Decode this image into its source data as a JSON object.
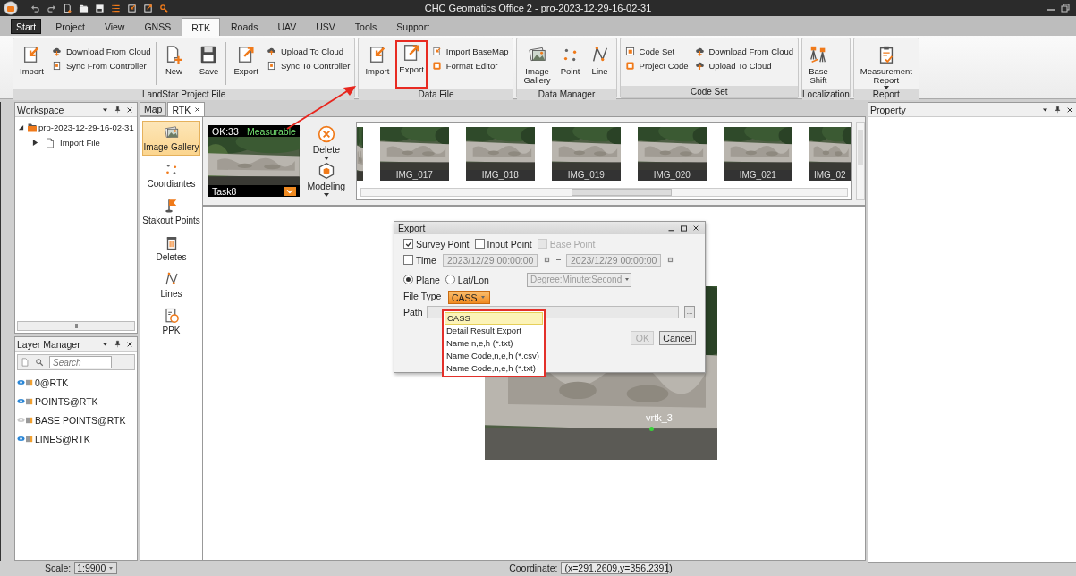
{
  "window": {
    "title": "CHC Geomatics Office 2 - pro-2023-12-29-16-02-31"
  },
  "ribbon_tabs": [
    {
      "label": "Start",
      "kind": "app",
      "selected": false
    },
    {
      "label": "Project",
      "kind": "tab",
      "selected": false
    },
    {
      "label": "View",
      "kind": "tab",
      "selected": false
    },
    {
      "label": "GNSS",
      "kind": "tab",
      "selected": false
    },
    {
      "label": "RTK",
      "kind": "tab",
      "selected": true
    },
    {
      "label": "Roads",
      "kind": "tab",
      "selected": false
    },
    {
      "label": "UAV",
      "kind": "tab",
      "selected": false
    },
    {
      "label": "USV",
      "kind": "tab",
      "selected": false
    },
    {
      "label": "Tools",
      "kind": "tab",
      "selected": false
    },
    {
      "label": "Support",
      "kind": "tab",
      "selected": false
    }
  ],
  "ribbon_groups": [
    {
      "label": "LandStar Project File",
      "columns": [
        {
          "kind": "large",
          "label": "Import"
        },
        {
          "kind": "stack",
          "items": [
            "Download From Cloud",
            "Sync From Controller"
          ]
        },
        {
          "kind": "large",
          "label": "New",
          "divider": true
        },
        {
          "kind": "large",
          "label": "Save",
          "divider": true
        },
        {
          "kind": "large",
          "label": "Export",
          "divider": true
        },
        {
          "kind": "stack",
          "items": [
            "Upload To Cloud",
            "Sync To Controller"
          ]
        }
      ]
    },
    {
      "label": "Data File",
      "columns": [
        {
          "kind": "large",
          "label": "Import"
        },
        {
          "kind": "large",
          "label": "Export",
          "highlighted": true
        },
        {
          "kind": "stack",
          "items": [
            "Import BaseMap",
            "Format Editor"
          ]
        }
      ]
    },
    {
      "label": "Data Manager",
      "columns": [
        {
          "kind": "large",
          "label": "Image Gallery"
        },
        {
          "kind": "large",
          "label": "Point"
        },
        {
          "kind": "large",
          "label": "Line"
        }
      ]
    },
    {
      "label": "Code Set",
      "columns": [
        {
          "kind": "stack",
          "items": [
            "Code Set",
            "Project Code"
          ]
        },
        {
          "kind": "stack",
          "items": [
            "Download From Cloud",
            "Upload To Cloud"
          ]
        }
      ]
    },
    {
      "label": "Localization",
      "columns": [
        {
          "kind": "large",
          "label": "Base Shift"
        }
      ]
    },
    {
      "label": "Report",
      "columns": [
        {
          "kind": "large",
          "label": "Measurement Report",
          "has_menu": true
        }
      ]
    }
  ],
  "workspace": {
    "title": "Workspace",
    "tree": [
      {
        "label": "pro-2023-12-29-16-02-31",
        "expanded": true,
        "children": [
          {
            "label": "Import File",
            "expanded": false
          }
        ]
      }
    ]
  },
  "layer_manager": {
    "title": "Layer Manager",
    "search": {
      "placeholder": "Search"
    },
    "layers": [
      {
        "name": "0@RTK",
        "visible": true
      },
      {
        "name": "POINTS@RTK",
        "visible": true
      },
      {
        "name": "BASE POINTS@RTK",
        "visible": false
      },
      {
        "name": "LINES@RTK",
        "visible": true
      }
    ]
  },
  "document_tabs": [
    {
      "label": "Map",
      "selected": false,
      "closable": false
    },
    {
      "label": "RTK",
      "selected": true,
      "closable": true
    }
  ],
  "tool_list": [
    {
      "label": "Image Gallery",
      "selected": true
    },
    {
      "label": "Coordiantes",
      "selected": false
    },
    {
      "label": "Stakout Points",
      "selected": false
    },
    {
      "label": "Deletes",
      "selected": false
    },
    {
      "label": "Lines",
      "selected": false
    },
    {
      "label": "PPK",
      "selected": false
    }
  ],
  "task_card": {
    "count": "OK:33",
    "status": "Measurable",
    "name": "Task8"
  },
  "strip_actions": [
    {
      "label": "Delete",
      "has_menu": true
    },
    {
      "label": "Modeling",
      "has_menu": true
    }
  ],
  "thumbnails": [
    {
      "label": "IMG_017"
    },
    {
      "label": "IMG_018"
    },
    {
      "label": "IMG_019"
    },
    {
      "label": "IMG_020"
    },
    {
      "label": "IMG_021"
    },
    {
      "label": "IMG_02"
    }
  ],
  "map": {
    "point_label": "vrtk_3"
  },
  "export_dialog": {
    "title": "Export",
    "point_types": [
      {
        "label": "Survey Point",
        "checked": true,
        "disabled": false
      },
      {
        "label": "Input Point",
        "checked": false,
        "disabled": false
      },
      {
        "label": "Base Point",
        "checked": false,
        "disabled": true
      }
    ],
    "time": {
      "label": "Time",
      "checked": false,
      "start": "2023/12/29 00:00:00",
      "end": "2023/12/29 00:00:00"
    },
    "coordinate_modes": [
      {
        "label": "Plane",
        "selected": true
      },
      {
        "label": "Lat/Lon",
        "selected": false
      }
    ],
    "angle_format": {
      "value": "Degree:Minute:Second",
      "disabled": true
    },
    "file_type": {
      "label": "File Type",
      "value": "CASS",
      "expanded": true,
      "options": [
        {
          "label": "CASS",
          "selected": true
        },
        {
          "label": "Detail Result Export",
          "selected": false
        },
        {
          "label": "Name,n,e,h (*.txt)",
          "selected": false
        },
        {
          "label": "Name,Code,n,e,h (*.csv)",
          "selected": false
        },
        {
          "label": "Name,Code,n,e,h (*.txt)",
          "selected": false
        }
      ]
    },
    "path": {
      "label": "Path",
      "browse": "..."
    },
    "buttons": [
      {
        "label": "OK",
        "disabled": true
      },
      {
        "label": "Cancel",
        "disabled": false
      }
    ]
  },
  "property_panel": {
    "title": "Property"
  },
  "status_bar": {
    "scale_label": "Scale:",
    "scale": "1:9900",
    "coordinate_label": "Coordinate:",
    "coordinate": "(x=291.2609,y=356.2391)"
  }
}
